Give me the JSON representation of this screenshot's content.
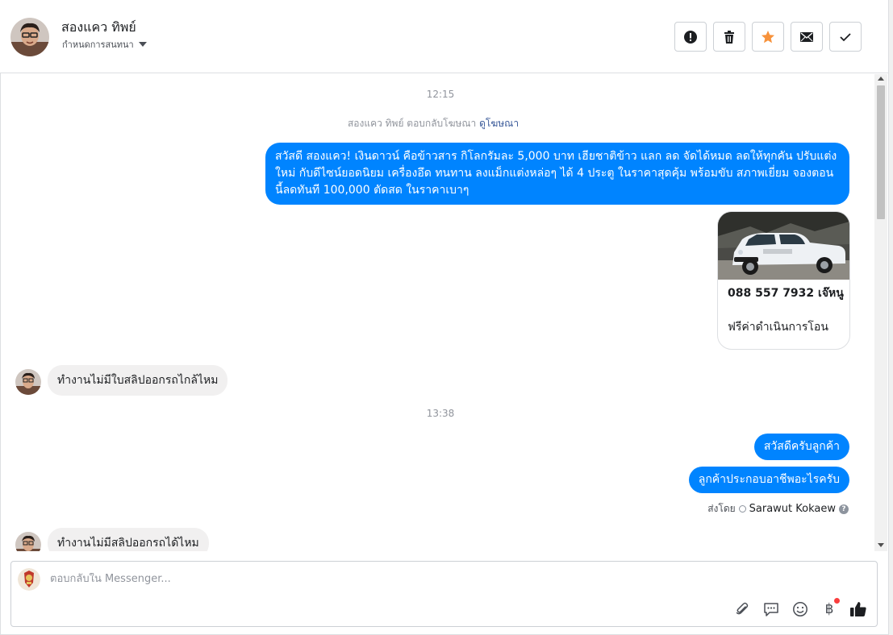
{
  "header": {
    "contact_name": "สองแคว ทิพย์",
    "assign_label": "กำหนดการสนทนา",
    "actions": [
      "spam",
      "delete",
      "star",
      "mark-unread",
      "done"
    ]
  },
  "conversation": {
    "time1": "12:15",
    "ad_reply_text": "สองแคว ทิพย์ ตอบกลับโฆษณา",
    "ad_reply_link": "ดูโฆษณา",
    "out_msg1": "สวัสดี สองแคว! เงินดาวน์ คือข้าวสาร กิโลกรัมละ 5,000 บาท เฮียชาติข้าว แลก ลด จัดได้หมด ลดให้ทุกคัน ปรับแต่งใหม่ กับดีไซน์ยอดนิยม เครื่องอึด ทนทาน ลงแม็กแต่งหล่อๆ ได้ 4 ประตู ในราคาสุดคุ้ม พร้อมขับ สภาพเยี่ยม จองตอนนี้ลดทันที 100,000 ตัดสด ในราคาเบาๆ",
    "card_title": "088 557 7932 เจ๊หนู",
    "card_subtitle": "ฟรีค่าดำเนินการโอน",
    "in_msg1": "ทำงานไม่มีใบสลิปออกรถไกล้ไหม",
    "time2": "13:38",
    "out_msg2": "สวัสดีครับลูกค้า",
    "out_msg3": "ลูกค้าประกอบอาชีพอะไรครับ",
    "sent_by_label": "ส่งโดย",
    "sent_by_agent": "Sarawut Kokaew",
    "in_msg2": "ทำงานไม่มีสลิปออกรถได้ไหม"
  },
  "composer": {
    "placeholder": "ตอบกลับใน Messenger..."
  },
  "colors": {
    "bubble_out": "#0084ff",
    "bubble_in": "#f1f0f0",
    "star": "#f7923b"
  }
}
